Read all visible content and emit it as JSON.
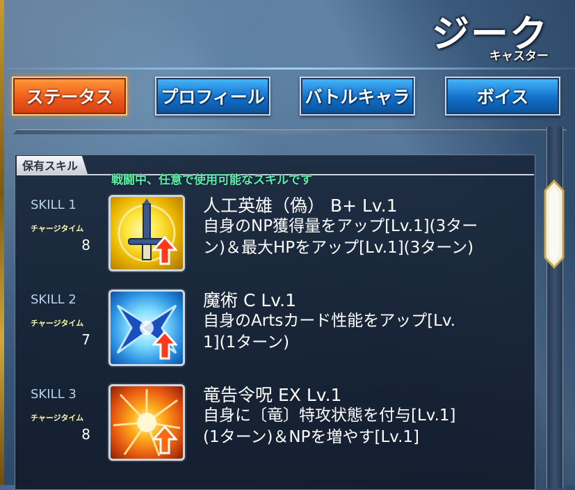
{
  "servant": {
    "name": "ジーク",
    "class": "キャスター"
  },
  "tabs": [
    {
      "label": "ステータス",
      "active": true
    },
    {
      "label": "プロフィール",
      "active": false
    },
    {
      "label": "バトルキャラ",
      "active": false
    },
    {
      "label": "ボイス",
      "active": false
    }
  ],
  "skills_panel": {
    "title": "保有スキル",
    "hint": "戦闘中、任意で使用可能なスキルです",
    "charge_label": "チャージタイム",
    "skills": [
      {
        "slot": "SKILL 1",
        "charge": "8",
        "name": "人工英雄（偽） B+ Lv.1",
        "desc_line1": "自身のNP獲得量をアップ[Lv.1](3ター",
        "desc_line2": "ン)＆最大HPをアップ[Lv.1](3ターン)",
        "icon": "sword-buff-icon"
      },
      {
        "slot": "SKILL 2",
        "charge": "7",
        "name": "魔術 C Lv.1",
        "desc_line1": "自身のArtsカード性能をアップ[Lv.",
        "desc_line2": "1](1ターン)",
        "icon": "arts-buff-icon"
      },
      {
        "slot": "SKILL 3",
        "charge": "8",
        "name": "竜告令呪 EX Lv.1",
        "desc_line1": "自身に〔竜〕特攻状態を付与[Lv.1]",
        "desc_line2": "(1ターン)＆NPを増やす[Lv.1]",
        "icon": "burst-buff-icon"
      }
    ]
  },
  "colors": {
    "active_tab": "#f0621e",
    "inactive_tab": "#1170c8",
    "hint_text": "#5cf0a0",
    "skill_label": "#b9d3ef",
    "charge_label": "#fff9a8"
  }
}
